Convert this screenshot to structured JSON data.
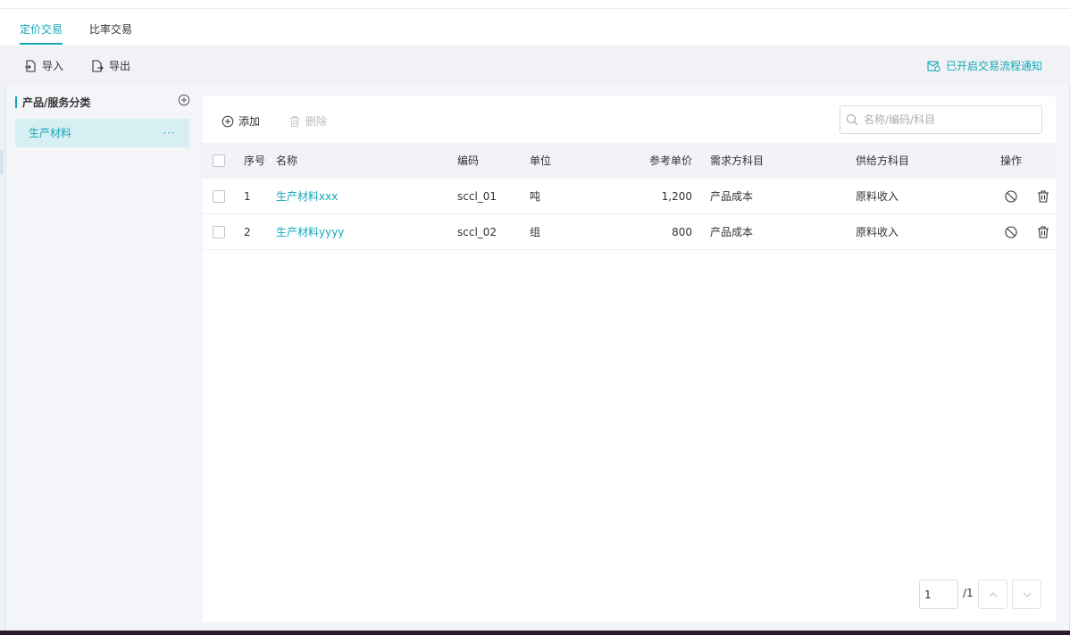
{
  "tabs": [
    {
      "label": "定价交易",
      "active": true
    },
    {
      "label": "比率交易",
      "active": false
    }
  ],
  "toolbar": {
    "import_label": "导入",
    "export_label": "导出",
    "notify_label": "已开启交易流程通知"
  },
  "sidebar": {
    "title": "产品/服务分类",
    "items": [
      {
        "label": "生产材料",
        "more": "···"
      }
    ]
  },
  "panel": {
    "add_label": "添加",
    "delete_label": "删除",
    "search_placeholder": "名称/编码/科目"
  },
  "table": {
    "headers": {
      "index": "序号",
      "name": "名称",
      "code": "编码",
      "unit": "单位",
      "price": "参考单价",
      "demand": "需求方科目",
      "supply": "供给方科目",
      "ops": "操作"
    },
    "rows": [
      {
        "index": "1",
        "name": "生产材料xxx",
        "code": "sccl_01",
        "unit": "吨",
        "price": "1,200",
        "demand": "产品成本",
        "supply": "原料收入"
      },
      {
        "index": "2",
        "name": "生产材料yyyy",
        "code": "sccl_02",
        "unit": "组",
        "price": "800",
        "demand": "产品成本",
        "supply": "原料收入"
      }
    ]
  },
  "pager": {
    "current": "1",
    "total": "/1"
  },
  "colors": {
    "accent": "#13a8b8"
  }
}
